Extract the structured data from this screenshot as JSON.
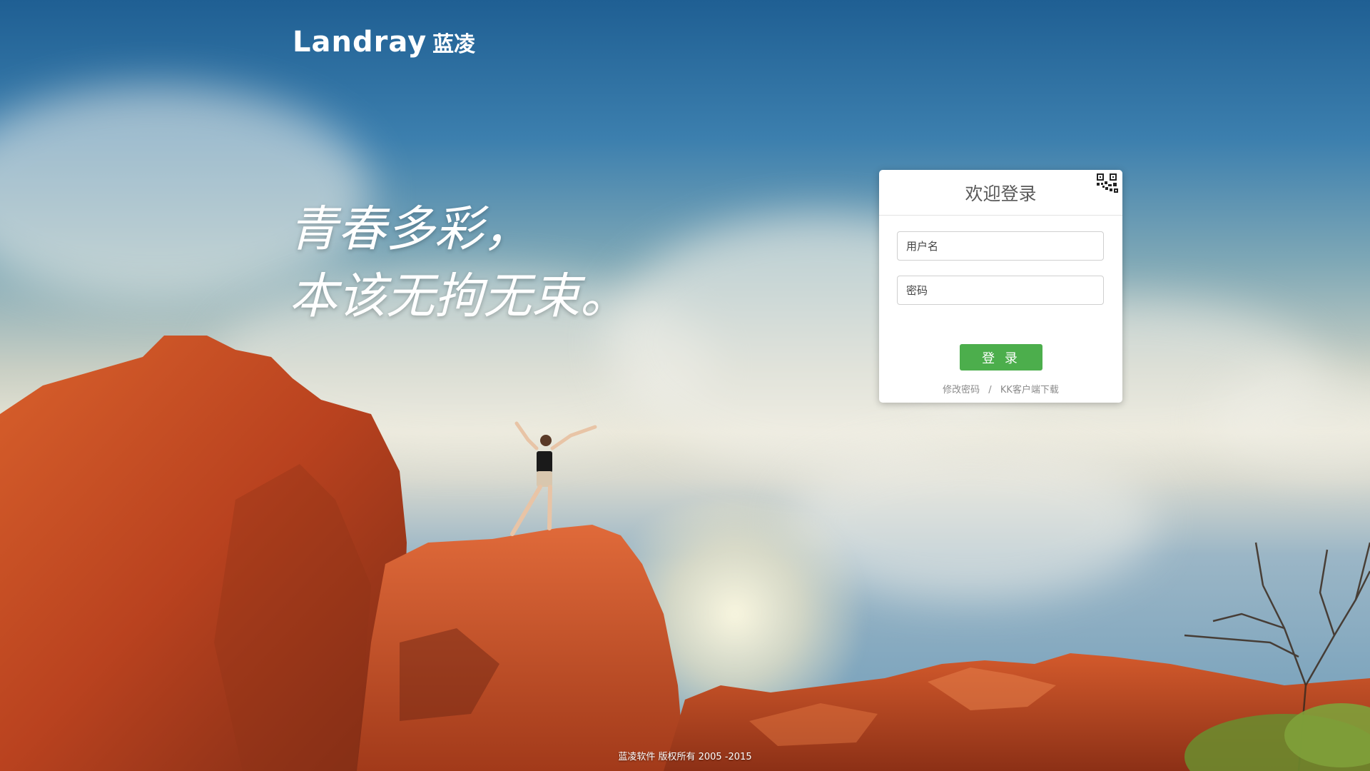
{
  "brand": {
    "name_en": "Landray",
    "name_cn": "蓝凌"
  },
  "slogan": {
    "line1": "青春多彩，",
    "line2": "本该无拘无束。"
  },
  "login": {
    "title": "欢迎登录",
    "qr_icon": "qr-code-icon",
    "username_placeholder": "用户名",
    "password_placeholder": "密码",
    "submit_label": "登 录",
    "change_password_link": "修改密码",
    "separator": "/",
    "kk_download_link": "KK客户端下载"
  },
  "footer": {
    "copyright": "蓝凌软件 版权所有 2005 -2015"
  },
  "colors": {
    "button_green": "#4cae4c",
    "sky_blue": "#2f6fa3",
    "rock_orange": "#c8522a"
  }
}
